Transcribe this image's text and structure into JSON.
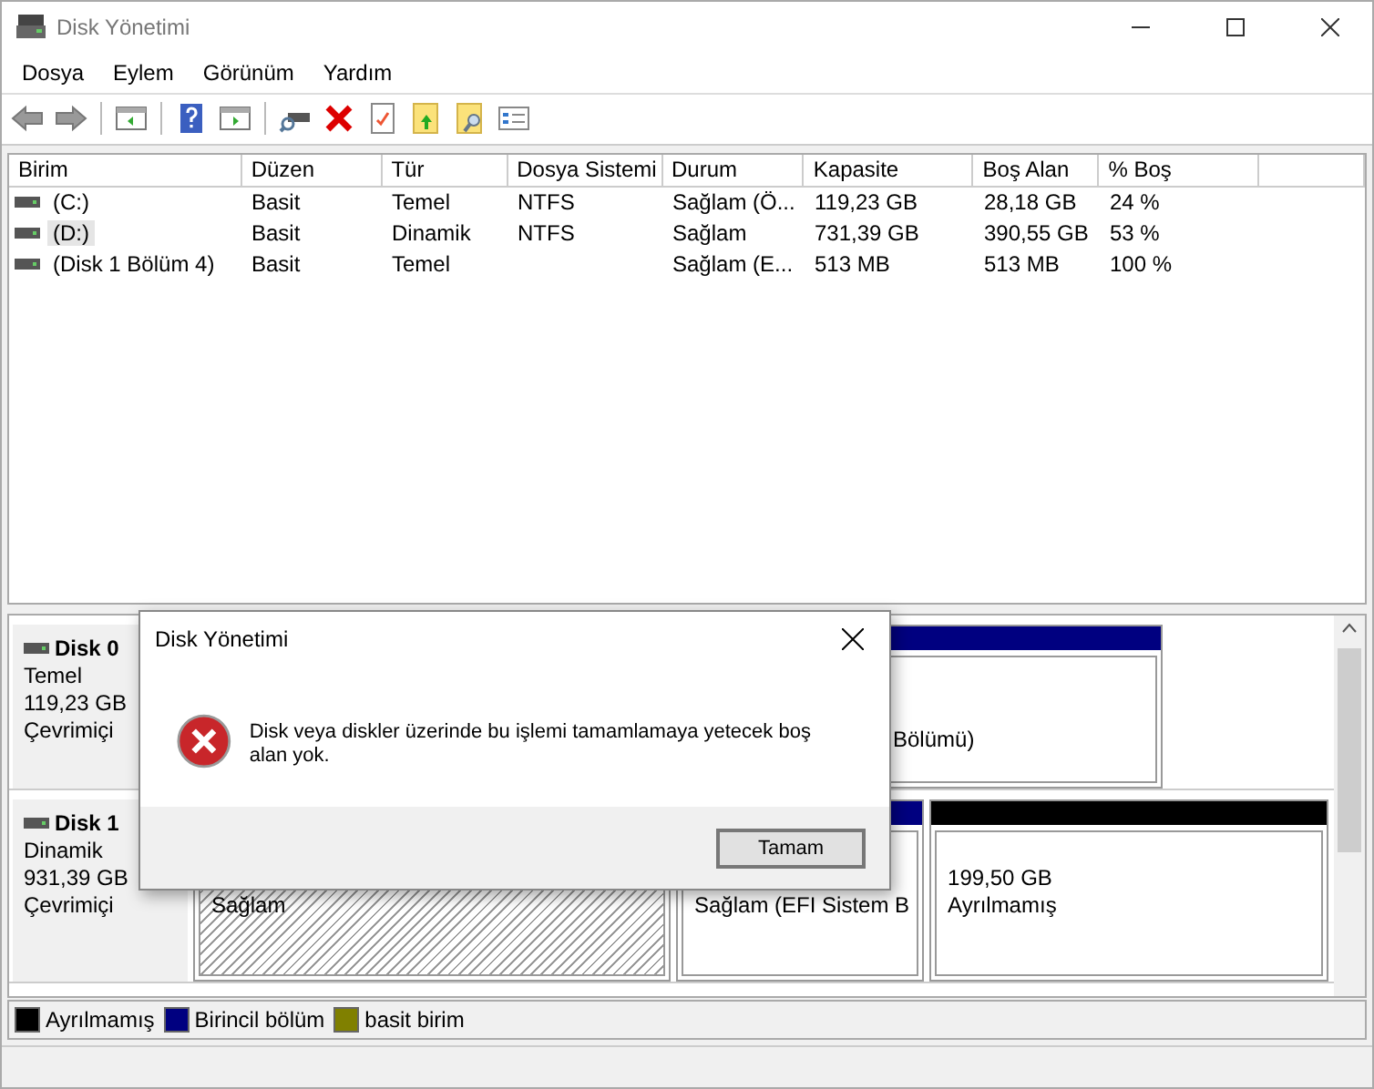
{
  "window": {
    "title": "Disk Yönetimi"
  },
  "menu": [
    "Dosya",
    "Eylem",
    "Görünüm",
    "Yardım"
  ],
  "table": {
    "columns": [
      "Birim",
      "Düzen",
      "Tür",
      "Dosya Sistemi",
      "Durum",
      "Kapasite",
      "Boş Alan",
      "% Boş"
    ],
    "rows": [
      {
        "cells": [
          "(C:)",
          "Basit",
          "Temel",
          "NTFS",
          "Sağlam (Ö...",
          "119,23 GB",
          "28,18 GB",
          "24 %"
        ],
        "selected": false
      },
      {
        "cells": [
          "(D:)",
          "Basit",
          "Dinamik",
          "NTFS",
          "Sağlam",
          "731,39 GB",
          "390,55 GB",
          "53 %"
        ],
        "selected": true
      },
      {
        "cells": [
          "(Disk 1 Bölüm 4)",
          "Basit",
          "Temel",
          "",
          "Sağlam (E...",
          "513 MB",
          "513 MB",
          "100 %"
        ],
        "selected": false
      }
    ]
  },
  "disks": [
    {
      "name": "Disk 0",
      "type": "Temel",
      "size": "119,23 GB",
      "status": "Çevrimiçi",
      "partitions": [
        {
          "kind": "primary",
          "selected": false,
          "lines": [
            "Bölümü)"
          ]
        }
      ]
    },
    {
      "name": "Disk 1",
      "type": "Dinamik",
      "size": "931,39 GB",
      "status": "Çevrimiçi",
      "partitions": [
        {
          "kind": "simple",
          "selected": true,
          "lines": [
            "Sağlam"
          ]
        },
        {
          "kind": "primary",
          "selected": false,
          "lines": [
            "Sağlam (EFI Sistem B"
          ]
        },
        {
          "kind": "unallocated",
          "selected": false,
          "lines": [
            "199,50 GB",
            "Ayrılmamış"
          ]
        }
      ]
    }
  ],
  "legend": [
    {
      "label": "Ayrılmamış",
      "color": "#000000"
    },
    {
      "label": "Birincil bölüm",
      "color": "#000080"
    },
    {
      "label": "basit birim",
      "color": "#808000"
    }
  ],
  "dialog": {
    "title": "Disk Yönetimi",
    "message": "Disk veya diskler üzerinde bu işlemi tamamlamaya yetecek boş alan yok.",
    "button": "Tamam"
  }
}
